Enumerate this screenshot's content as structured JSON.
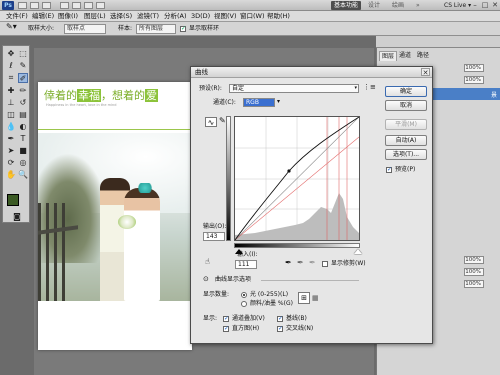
{
  "app": {
    "logo": "Ps",
    "workspace_button": "基本功能",
    "workspace_links": [
      "设计",
      "绘画",
      "»"
    ],
    "cs_live": "CS Live ▾",
    "window_controls": [
      "–",
      "□",
      "✕"
    ]
  },
  "menu": [
    "文件(F)",
    "编辑(E)",
    "图像(I)",
    "图层(L)",
    "选择(S)",
    "滤镜(T)",
    "分析(A)",
    "3D(D)",
    "视图(V)",
    "窗口(W)",
    "帮助(H)"
  ],
  "options_bar": {
    "sample_size_label": "取样大小:",
    "sample_size_value": "取样点",
    "sample_label": "样本:",
    "sample_value": "所有图层",
    "show_ring_label": "显示取样环"
  },
  "document": {
    "title_part1": "倖着的",
    "title_hl1": "幸福",
    "title_part2": "，想着的",
    "title_hl2": "爱",
    "subtitle": "Happiness in the heart, love in the mind"
  },
  "panels": {
    "tabs": [
      "图层",
      "通道",
      "路径"
    ],
    "opacity_1": "100%",
    "opacity_2": "100%",
    "opacity_3": "100%",
    "opacity_4": "100%",
    "opacity_5": "100%",
    "layer_label": "景"
  },
  "curves": {
    "title": "曲线",
    "preset_label": "预设(R):",
    "preset_value": "自定",
    "channel_label": "通道(C):",
    "channel_value": "RGB",
    "output_label": "输出(O):",
    "output_value": "143",
    "input_label": "输入(I):",
    "input_value": "111",
    "show_clipping_label": "显示修剪(W)",
    "curve_display_options": "曲线显示选项",
    "show_amount_label": "显示数量:",
    "light_label": "光 (0-255)(L)",
    "pigment_label": "颜料/油墨 %(G)",
    "show_label": "显示:",
    "channel_overlays_label": "通道叠加(V)",
    "baseline_label": "基线(B)",
    "histogram_label": "直方图(H)",
    "intersection_label": "交叉线(N)",
    "buttons": {
      "ok": "确定",
      "cancel": "取消",
      "smooth": "平滑(M)",
      "auto": "自动(A)",
      "options": "选项(T)..."
    },
    "preview_label": "预览(P)",
    "curve_points": [
      [
        0,
        0
      ],
      [
        56,
        78
      ],
      [
        111,
        143
      ],
      [
        180,
        200
      ],
      [
        255,
        255
      ]
    ]
  }
}
